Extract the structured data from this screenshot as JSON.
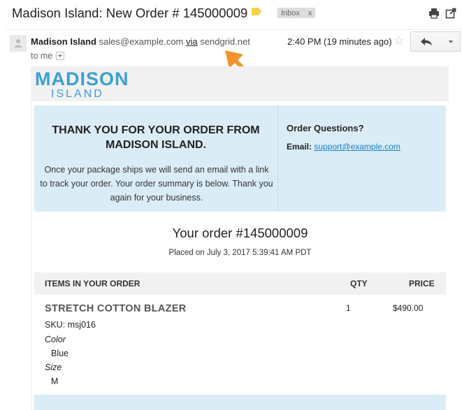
{
  "header": {
    "subject": "Madison Island: New Order # 145000009",
    "label_chip": "Inbox",
    "label_remove": "x"
  },
  "message": {
    "sender_name": "Madison Island",
    "sender_email": "sales@example.com",
    "via_label": "via",
    "via_domain": "sendgrid.net",
    "time": "2:40 PM (19 minutes ago)",
    "recipient": "to me"
  },
  "email": {
    "logo_top": "MADISON",
    "logo_bottom": "ISLAND",
    "thanks_heading": "THANK YOU FOR YOUR ORDER FROM MADISON ISLAND.",
    "thanks_body": "Once your package ships we will send an email with a link to track your order. Your order summary is below. Thank you again for your business.",
    "questions_title": "Order Questions?",
    "questions_email_label": "Email:",
    "questions_email": "support@example.com",
    "order_title": "Your order #145000009",
    "placed_on": "Placed on July 3, 2017 5:39:41 AM PDT",
    "table_headers": {
      "items": "ITEMS IN YOUR ORDER",
      "qty": "QTY",
      "price": "PRICE"
    },
    "item": {
      "name": "STRETCH COTTON BLAZER",
      "sku": "SKU: msj016",
      "color_label": "Color",
      "color_value": "Blue",
      "size_label": "Size",
      "size_value": "M",
      "qty": "1",
      "price": "$490.00"
    }
  },
  "colors": {
    "brand_blue": "#3d9fd3",
    "info_box": "#daedf7",
    "annotation_arrow": "#f5922b",
    "label_tag": "#f7d34a"
  },
  "icons": [
    "label-tag-icon",
    "print-icon",
    "new-window-icon",
    "avatar-icon",
    "star-icon",
    "reply-icon",
    "dropdown-caret-icon",
    "annotation-arrow-icon"
  ]
}
